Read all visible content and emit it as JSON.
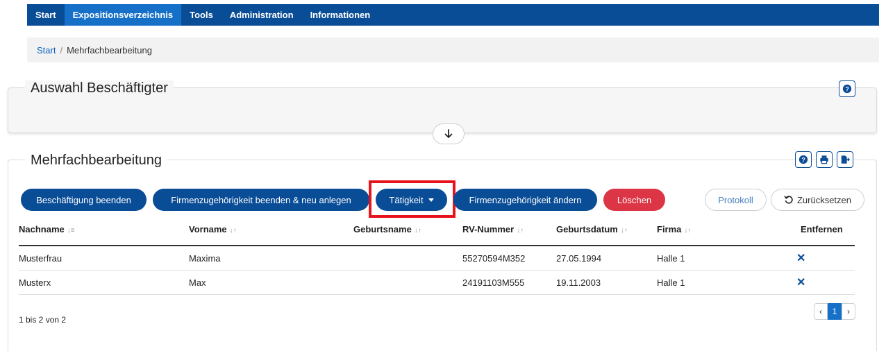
{
  "nav": {
    "items": [
      "Start",
      "Expositionsverzeichnis",
      "Tools",
      "Administration",
      "Informationen"
    ],
    "active_index": 1
  },
  "breadcrumb": {
    "home": "Start",
    "separator": "/",
    "current": "Mehrfachbearbeitung"
  },
  "panel_selection": {
    "title": "Auswahl Beschäftigter"
  },
  "panel_bulk": {
    "title": "Mehrfachbearbeitung"
  },
  "actions": {
    "end_employment": "Beschäftigung beenden",
    "end_company_new": "Firmenzugehörigkeit beenden & neu anlegen",
    "activity": "Tätigkeit",
    "change_company": "Firmenzugehörigkeit ändern",
    "delete": "Löschen",
    "log": "Protokoll",
    "reset": "Zurücksetzen"
  },
  "table": {
    "headers": {
      "lastname": "Nachname",
      "firstname": "Vorname",
      "birthname": "Geburtsname",
      "rv": "RV-Nummer",
      "birthdate": "Geburtsdatum",
      "company": "Firma",
      "remove": "Entfernen"
    },
    "sort_icon_asc": "↓≡",
    "sort_icon": "↓↑",
    "rows": [
      {
        "lastname": "Musterfrau",
        "firstname": "Maxima",
        "birthname": "",
        "rv": "55270594M352",
        "birthdate": "27.05.1994",
        "company": "Halle 1",
        "remove": "✕"
      },
      {
        "lastname": "Musterx",
        "firstname": "Max",
        "birthname": "",
        "rv": "24191103M555",
        "birthdate": "19.11.2003",
        "company": "Halle 1",
        "remove": "✕"
      }
    ]
  },
  "pagination": {
    "info": "1 bis 2 von 2",
    "prev": "‹",
    "page": "1",
    "next": "›"
  },
  "colors": {
    "primary": "#0a4d97",
    "active_nav": "#1670c8",
    "danger": "#dc3545",
    "highlight": "#e8141c"
  },
  "icons": [
    "help-icon",
    "arrow-down-icon",
    "print-icon",
    "export-icon",
    "reset-icon",
    "caret-down-icon"
  ]
}
